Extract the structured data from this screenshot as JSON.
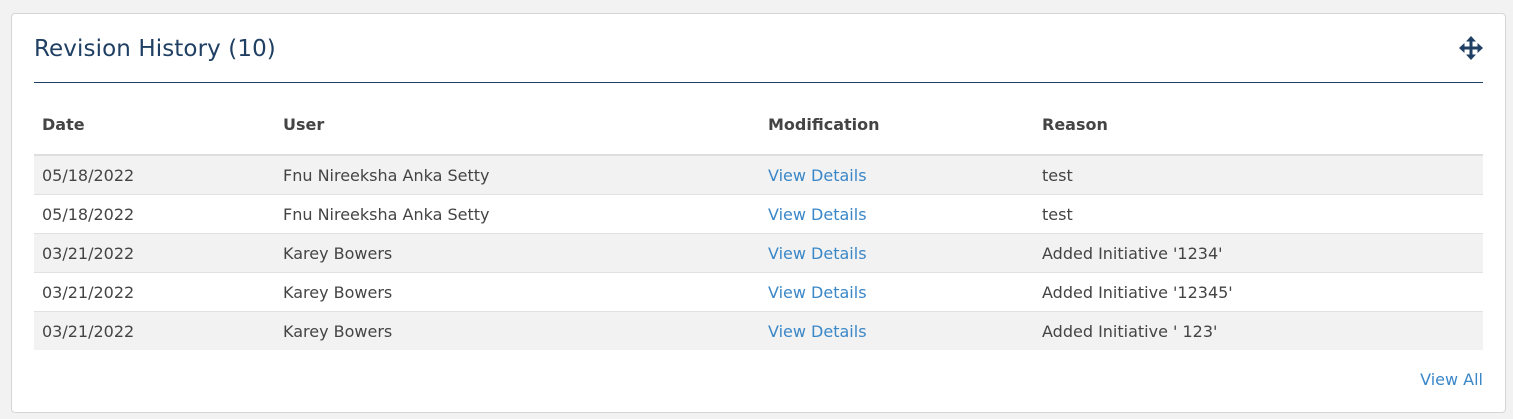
{
  "panel": {
    "title": "Revision History (10)",
    "move_icon": "move-arrows-icon",
    "view_all_label": "View All"
  },
  "table": {
    "headers": {
      "date": "Date",
      "user": "User",
      "modification": "Modification",
      "reason": "Reason"
    },
    "rows": [
      {
        "date": "05/18/2022",
        "user": "Fnu Nireeksha Anka Setty",
        "modification": "View Details",
        "reason": "test"
      },
      {
        "date": "05/18/2022",
        "user": "Fnu Nireeksha Anka Setty",
        "modification": "View Details",
        "reason": "test"
      },
      {
        "date": "03/21/2022",
        "user": "Karey Bowers",
        "modification": "View Details",
        "reason": "Added Initiative '1234'"
      },
      {
        "date": "03/21/2022",
        "user": "Karey Bowers",
        "modification": "View Details",
        "reason": "Added Initiative '12345'"
      },
      {
        "date": "03/21/2022",
        "user": "Karey Bowers",
        "modification": "View Details",
        "reason": "Added Initiative ' 123'"
      }
    ]
  },
  "colors": {
    "title": "#1f3f63",
    "link": "#3a87c8",
    "row_stripe": "#f2f2f2"
  }
}
